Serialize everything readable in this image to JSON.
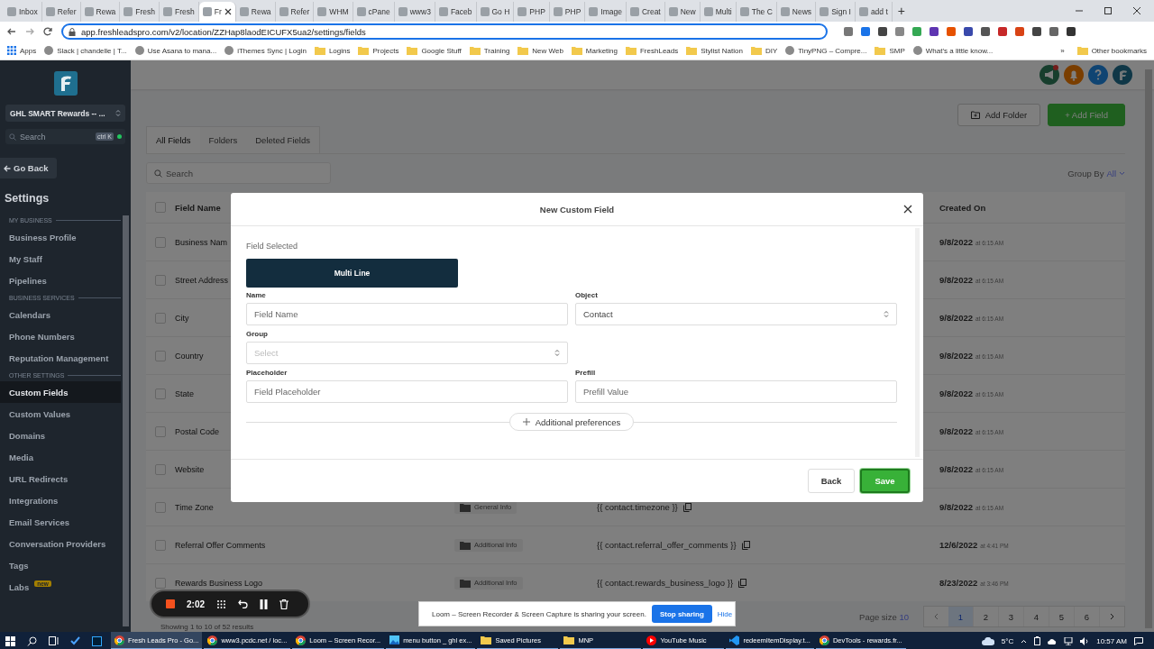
{
  "browser": {
    "tabs": [
      {
        "label": "Inbox",
        "selected": false
      },
      {
        "label": "Refer",
        "selected": false
      },
      {
        "label": "Rewa",
        "selected": false
      },
      {
        "label": "Fresh",
        "selected": false
      },
      {
        "label": "Fresh",
        "selected": false
      },
      {
        "label": "Fr",
        "selected": true
      },
      {
        "label": "Rewa",
        "selected": false
      },
      {
        "label": "Refer",
        "selected": false
      },
      {
        "label": "WHM",
        "selected": false
      },
      {
        "label": "cPane",
        "selected": false
      },
      {
        "label": "www3",
        "selected": false
      },
      {
        "label": "Faceb",
        "selected": false
      },
      {
        "label": "Go H",
        "selected": false
      },
      {
        "label": "PHP",
        "selected": false
      },
      {
        "label": "PHP",
        "selected": false
      },
      {
        "label": "Image",
        "selected": false
      },
      {
        "label": "Creat",
        "selected": false
      },
      {
        "label": "New",
        "selected": false
      },
      {
        "label": "Multi",
        "selected": false
      },
      {
        "label": "The C",
        "selected": false
      },
      {
        "label": "News",
        "selected": false
      },
      {
        "label": "Sign I",
        "selected": false
      },
      {
        "label": "add t",
        "selected": false
      }
    ],
    "new_tab": "+",
    "address": "app.freshleadspro.com/v2/location/ZZHap8laodEICUFX5ua2/settings/fields",
    "bookmarks": [
      {
        "label": "Apps",
        "kind": "apps"
      },
      {
        "label": "Slack | chandelle | T...",
        "kind": "site"
      },
      {
        "label": "Use Asana to mana...",
        "kind": "site"
      },
      {
        "label": "iThemes Sync | Login",
        "kind": "site"
      },
      {
        "label": "Logins",
        "kind": "folder"
      },
      {
        "label": "Projects",
        "kind": "folder"
      },
      {
        "label": "Google Stuff",
        "kind": "folder"
      },
      {
        "label": "Training",
        "kind": "folder"
      },
      {
        "label": "New Web",
        "kind": "folder"
      },
      {
        "label": "Marketing",
        "kind": "folder"
      },
      {
        "label": "FreshLeads",
        "kind": "folder"
      },
      {
        "label": "Stylist Nation",
        "kind": "folder"
      },
      {
        "label": "DIY",
        "kind": "folder"
      },
      {
        "label": "TinyPNG – Compre...",
        "kind": "site"
      },
      {
        "label": "SMP",
        "kind": "folder"
      },
      {
        "label": "What's a little know...",
        "kind": "site"
      }
    ],
    "more": "»",
    "other_bookmarks": "Other bookmarks"
  },
  "sidebar": {
    "location": "GHL SMART Rewards -- ...",
    "search": {
      "placeholder": "Search",
      "shortcut": "ctrl K"
    },
    "back": "Go Back",
    "heading": "Settings",
    "sections": [
      {
        "title": "MY BUSINESS",
        "items": [
          {
            "label": "Business Profile",
            "selected": false
          },
          {
            "label": "My Staff",
            "selected": false
          },
          {
            "label": "Pipelines",
            "selected": false
          }
        ]
      },
      {
        "title": "BUSINESS SERVICES",
        "items": [
          {
            "label": "Calendars",
            "selected": false
          },
          {
            "label": "Phone Numbers",
            "selected": false
          },
          {
            "label": "Reputation Management",
            "selected": false
          }
        ]
      },
      {
        "title": "OTHER SETTINGS",
        "items": [
          {
            "label": "Custom Fields",
            "selected": true
          },
          {
            "label": "Custom Values",
            "selected": false
          },
          {
            "label": "Domains",
            "selected": false
          },
          {
            "label": "Media",
            "selected": false
          },
          {
            "label": "URL Redirects",
            "selected": false
          },
          {
            "label": "Integrations",
            "selected": false
          },
          {
            "label": "Email Services",
            "selected": false
          },
          {
            "label": "Conversation Providers",
            "selected": false
          },
          {
            "label": "Tags",
            "selected": false
          },
          {
            "label": "Labs",
            "selected": false,
            "badge": "new"
          }
        ]
      }
    ]
  },
  "main": {
    "actions": {
      "add_folder": "Add Folder",
      "add_field": "+ Add Field"
    },
    "tabs": [
      {
        "label": "All Fields",
        "selected": true
      },
      {
        "label": "Folders",
        "selected": false
      },
      {
        "label": "Deleted Fields",
        "selected": false
      }
    ],
    "search": {
      "placeholder": "Search"
    },
    "group_by": {
      "label": "Group By",
      "value": "All"
    },
    "table": {
      "select_all_checked": false,
      "columns": [
        "Field Name",
        "Created On"
      ],
      "rows": [
        {
          "checked": false,
          "name": "Business Nam",
          "date": "9/8/2022",
          "time": "at 6:15 AM"
        },
        {
          "checked": false,
          "name": "Street Address",
          "date": "9/8/2022",
          "time": "at 6:15 AM"
        },
        {
          "checked": false,
          "name": "City",
          "date": "9/8/2022",
          "time": "at 6:15 AM"
        },
        {
          "checked": false,
          "name": "Country",
          "date": "9/8/2022",
          "time": "at 6:15 AM"
        },
        {
          "checked": false,
          "name": "State",
          "date": "9/8/2022",
          "time": "at 6:15 AM"
        },
        {
          "checked": false,
          "name": "Postal Code",
          "date": "9/8/2022",
          "time": "at 6:15 AM"
        },
        {
          "checked": false,
          "name": "Website",
          "date": "9/8/2022",
          "time": "at 6:15 AM"
        },
        {
          "checked": false,
          "name": "Time Zone",
          "folder": "General Info",
          "key": "{{ contact.timezone }}",
          "date": "9/8/2022",
          "time": "at 6:15 AM"
        },
        {
          "checked": false,
          "name": "Referral Offer Comments",
          "folder": "Additional Info",
          "key": "{{ contact.referral_offer_comments }}",
          "date": "12/6/2022",
          "time": "at 4:41 PM"
        },
        {
          "checked": false,
          "name": "Rewards Business Logo",
          "folder": "Additional Info",
          "key": "{{ contact.rewards_business_logo }}",
          "date": "8/23/2022",
          "time": "at 3:46 PM"
        }
      ]
    },
    "summary": "Showing 1 to 10 of 52 results",
    "pagination": {
      "page_size_label": "Page size",
      "page_size": "10",
      "pages": [
        {
          "label": "1",
          "selected": true
        },
        {
          "label": "2",
          "selected": false
        },
        {
          "label": "3",
          "selected": false
        },
        {
          "label": "4",
          "selected": false
        },
        {
          "label": "5",
          "selected": false
        },
        {
          "label": "6",
          "selected": false
        }
      ]
    }
  },
  "modal": {
    "title": "New Custom Field",
    "field_selected_label": "Field Selected",
    "field_type": "Multi Line",
    "rows": [
      [
        {
          "label": "Name",
          "kind": "text",
          "placeholder": "Field Name"
        },
        {
          "label": "Object",
          "kind": "select",
          "value": "Contact"
        }
      ],
      [
        {
          "label": "Group",
          "kind": "select",
          "placeholder": "Select"
        }
      ],
      [
        {
          "label": "Placeholder",
          "kind": "text",
          "placeholder": "Field Placeholder"
        },
        {
          "label": "Prefill",
          "kind": "text",
          "placeholder": "Prefill Value"
        }
      ]
    ],
    "more": "Additional preferences",
    "buttons": [
      {
        "label": "Back",
        "kind": "secondary"
      },
      {
        "label": "Save",
        "kind": "primary"
      }
    ]
  },
  "loom": {
    "timer": "2:02"
  },
  "share_bar": {
    "message": "Loom – Screen Recorder & Screen Capture is sharing your screen.",
    "stop": "Stop sharing",
    "hide": "Hide"
  },
  "taskbar": {
    "apps": [
      {
        "label": "Fresh Leads Pro - Go...",
        "kind": "browser",
        "selected": true
      },
      {
        "label": "www3.pcdc.net / loc...",
        "kind": "browser",
        "selected": false
      },
      {
        "label": "Loom – Screen Recor...",
        "kind": "browser",
        "selected": false
      },
      {
        "label": "menu button _ ghl ex...",
        "kind": "image",
        "selected": false
      },
      {
        "label": "Saved Pictures",
        "kind": "folder",
        "selected": false
      },
      {
        "label": "MNP",
        "kind": "folder",
        "selected": false
      },
      {
        "label": "YouTube Music",
        "kind": "music",
        "selected": false
      },
      {
        "label": "redeemItemDisplay.t...",
        "kind": "editor",
        "selected": false
      },
      {
        "label": "DevTools - rewards.fr...",
        "kind": "browser",
        "selected": false
      }
    ],
    "weather": "5°C",
    "time": "10:57 AM"
  }
}
